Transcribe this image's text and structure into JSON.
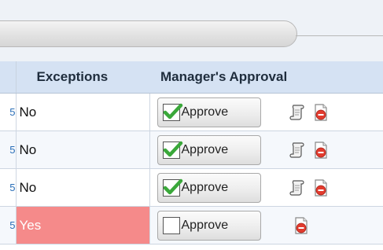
{
  "table": {
    "columns": {
      "exceptions": "Exceptions",
      "approval": "Manager's Approval"
    },
    "rows": [
      {
        "lead": "5",
        "exceptions": "No",
        "approve_label": "Approve",
        "checked": true,
        "icons": [
          "scroll-icon",
          "document-delete-icon"
        ]
      },
      {
        "lead": "5",
        "exceptions": "No",
        "approve_label": "Approve",
        "checked": true,
        "icons": [
          "scroll-icon",
          "document-delete-icon"
        ]
      },
      {
        "lead": "5",
        "exceptions": "No",
        "approve_label": "Approve",
        "checked": true,
        "icons": [
          "scroll-icon",
          "document-delete-icon"
        ]
      },
      {
        "lead": "5",
        "exceptions": "Yes",
        "approve_label": "Approve",
        "checked": false,
        "icons": [
          "document-delete-icon"
        ]
      }
    ]
  },
  "colors": {
    "header_bg": "#d5e2f3",
    "exception_flag": "#f58a8a",
    "check_green": "#3aa83a",
    "delete_red": "#e23b2e"
  }
}
